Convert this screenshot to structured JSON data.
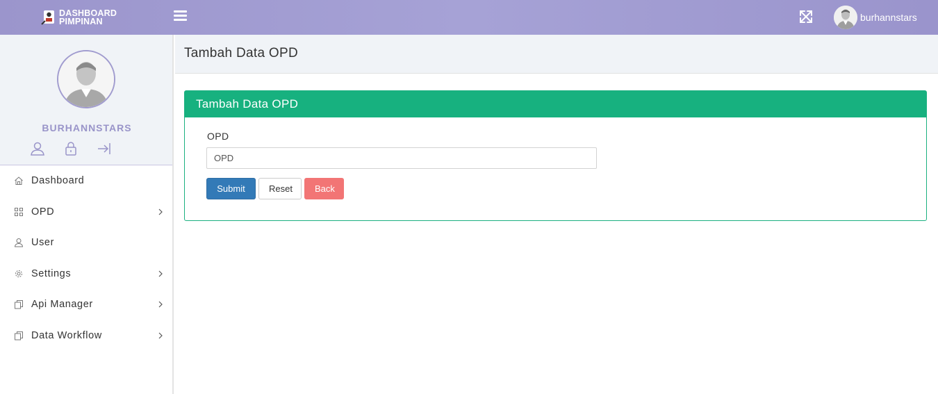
{
  "header": {
    "logo_line1": "DASHBOARD",
    "logo_line2": "PIMPINAN",
    "username": "burhannstars"
  },
  "sidebar": {
    "profile_name": "BURHANNSTARS",
    "items": [
      {
        "label": "Dashboard",
        "icon": "home-icon",
        "has_submenu": false
      },
      {
        "label": "OPD",
        "icon": "grid-icon",
        "has_submenu": true
      },
      {
        "label": "User",
        "icon": "user-icon",
        "has_submenu": false
      },
      {
        "label": "Settings",
        "icon": "gear-icon",
        "has_submenu": true
      },
      {
        "label": "Api Manager",
        "icon": "copy-icon",
        "has_submenu": true
      },
      {
        "label": "Data Workflow",
        "icon": "copy-icon",
        "has_submenu": true
      }
    ]
  },
  "page": {
    "title": "Tambah Data OPD"
  },
  "form": {
    "card_title": "Tambah Data OPD",
    "field_label": "OPD",
    "field_placeholder": "OPD",
    "field_value": "",
    "submit_label": "Submit",
    "reset_label": "Reset",
    "back_label": "Back"
  },
  "colors": {
    "header_bg": "#9b95cc",
    "accent_green": "#17b17f",
    "submit_blue": "#337ab7",
    "back_red": "#f27575",
    "profile_name": "#9994c9"
  }
}
